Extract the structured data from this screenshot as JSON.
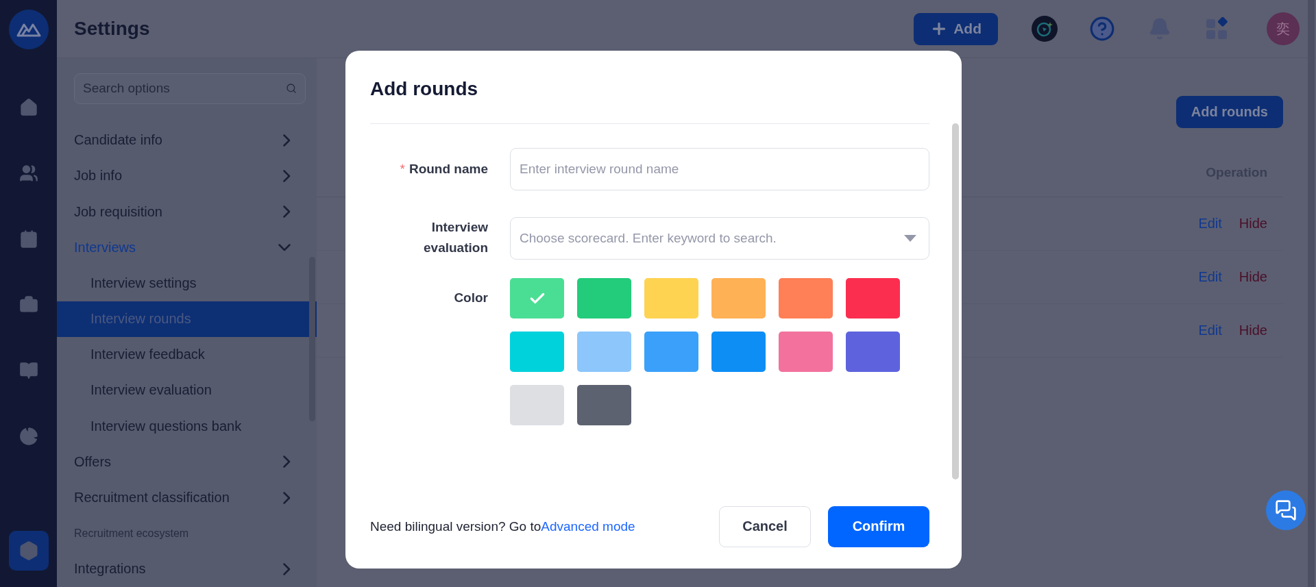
{
  "header": {
    "title": "Settings",
    "add_button": "Add",
    "avatar": "奕"
  },
  "sidebar": {
    "search": {
      "placeholder": "Search options"
    },
    "items": [
      {
        "kind": "group",
        "label": "Candidate info",
        "expanded": false,
        "selected": false
      },
      {
        "kind": "group",
        "label": "Job info",
        "expanded": false,
        "selected": false
      },
      {
        "kind": "group",
        "label": "Job requisition",
        "expanded": false,
        "selected": false
      },
      {
        "kind": "group",
        "label": "Interviews",
        "expanded": true,
        "selected": true,
        "children": [
          {
            "label": "Interview settings",
            "selected": false
          },
          {
            "label": "Interview rounds",
            "selected": true
          },
          {
            "label": "Interview feedback",
            "selected": false
          },
          {
            "label": "Interview evaluation",
            "selected": false
          },
          {
            "label": "Interview questions bank",
            "selected": false
          }
        ]
      },
      {
        "kind": "group",
        "label": "Offers",
        "expanded": false,
        "selected": false
      },
      {
        "kind": "group",
        "label": "Recruitment classification",
        "expanded": false,
        "selected": false
      },
      {
        "kind": "heading",
        "label": "Recruitment ecosystem"
      },
      {
        "kind": "group",
        "label": "Integrations",
        "expanded": false,
        "selected": false
      }
    ]
  },
  "content": {
    "add_rounds_button": "Add rounds",
    "column_header": "Operation",
    "rows": [
      {
        "edit": "Edit",
        "hide": "Hide"
      },
      {
        "edit": "Edit",
        "hide": "Hide"
      },
      {
        "edit": "Edit",
        "hide": "Hide"
      }
    ]
  },
  "dialog": {
    "title": "Add rounds",
    "round_name": {
      "label": "Round name",
      "required_mark": "*",
      "placeholder": "Enter interview round name"
    },
    "interview_evaluation": {
      "label": "Interview evaluation",
      "placeholder": "Choose scorecard. Enter keyword to search."
    },
    "color": {
      "label": "Color",
      "swatches": [
        {
          "color": "#4ade94",
          "selected": true
        },
        {
          "color": "#22cc7a",
          "selected": false
        },
        {
          "color": "#ffd352",
          "selected": false
        },
        {
          "color": "#ffb155",
          "selected": false
        },
        {
          "color": "#ff7f56",
          "selected": false
        },
        {
          "color": "#fb2e50",
          "selected": false
        },
        {
          "color": "#00d2dc",
          "selected": false
        },
        {
          "color": "#8cc6fb",
          "selected": false
        },
        {
          "color": "#3ba0fa",
          "selected": false
        },
        {
          "color": "#0d8ef5",
          "selected": false
        },
        {
          "color": "#f2729d",
          "selected": false
        },
        {
          "color": "#5e63dd",
          "selected": false
        },
        {
          "color": "#dedfe3",
          "selected": false
        },
        {
          "color": "#5c6270",
          "selected": false
        }
      ]
    },
    "footer_text": "Need bilingual version? Go to",
    "footer_link": "Advanced mode",
    "buttons": {
      "cancel": "Cancel",
      "confirm": "Confirm"
    }
  }
}
